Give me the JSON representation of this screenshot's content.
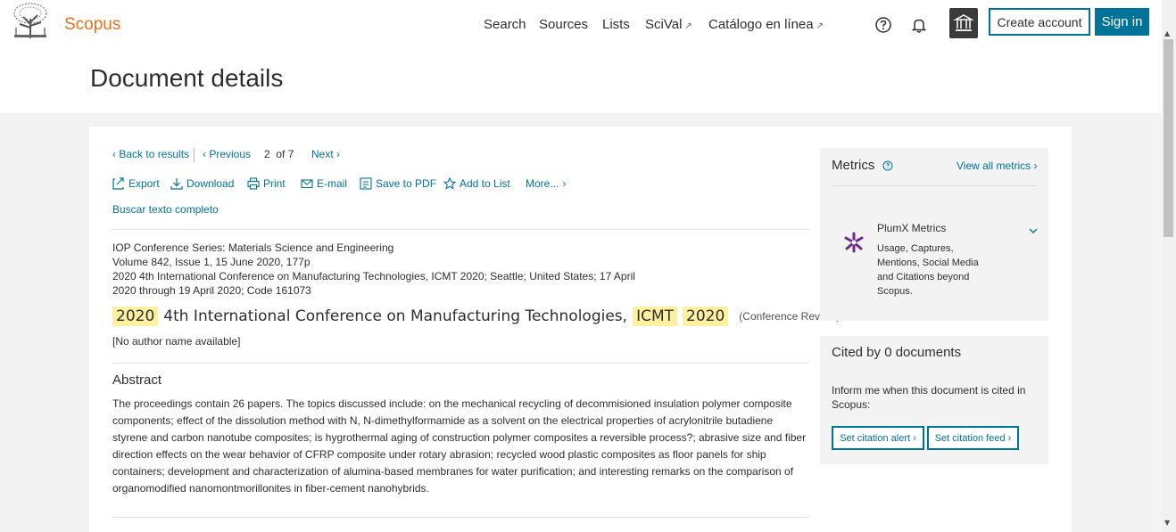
{
  "header": {
    "brand": "Scopus",
    "nav": [
      {
        "label": "Search"
      },
      {
        "label": "Sources"
      },
      {
        "label": "Lists"
      },
      {
        "label": "SciVal",
        "ext": "↗"
      },
      {
        "label": "Catálogo en línea",
        "ext": "↗"
      }
    ],
    "create_account": "Create account",
    "sign_in": "Sign in"
  },
  "page_title": "Document details",
  "pager": {
    "back": "Back to results",
    "previous": "Previous",
    "current": "2",
    "of": "of",
    "total": "7",
    "next": "Next"
  },
  "toolbar": {
    "export": "Export",
    "download": "Download",
    "print": "Print",
    "email": "E-mail",
    "save_pdf": "Save to PDF",
    "add_list": "Add to List",
    "more": "More..."
  },
  "buscar": "Buscar texto completo",
  "source": {
    "journal": "IOP Conference Series: Materials Science and Engineering",
    "volume": "Volume 842, Issue 1, 15 June 2020, 177p",
    "conf_line1": "2020 4th International Conference on Manufacturing Technologies, ICMT 2020; Seattle; United States; 17 April",
    "conf_line2": "2020 through 19 April 2020; Code 161073"
  },
  "title": {
    "hl1": "2020",
    "text": "4th International Conference on Manufacturing Technologies,",
    "hl2": "ICMT",
    "hl3": "2020",
    "type": "(Conference Review)"
  },
  "authors": "[No author name available]",
  "abstract": {
    "heading": "Abstract",
    "text": "The proceedings contain 26 papers. The topics discussed include: on the mechanical recycling of decommisioned insulation polymer composite components; effect of the dissolution method with N, N-dimethylformamide as a solvent on the electrical properties of acrylonitrile butadiene styrene and carbon nanotube composites; is hygrothermal aging of construction polymer composites a reversible process?; abrasive size and fiber direction effects on the wear behavior of CFRP composite under rotary abrasion; recycled wood plastic composites as floor panels for ship containers; development and characterization of alumina-based membranes for water purification; and interesting remarks on the comparison of organomodified nanomontmorillonites in fiber-cement nanohybrids."
  },
  "metrics": {
    "heading": "Metrics",
    "view_all": "View all metrics",
    "plumx_title": "PlumX Metrics",
    "plumx_desc": "Usage, Captures, Mentions, Social Media and Citations beyond Scopus."
  },
  "cited": {
    "heading": "Cited by 0 documents",
    "inform": "Inform me when this document is cited in Scopus:",
    "alert_btn": "Set citation alert",
    "feed_btn": "Set citation feed"
  },
  "colors": {
    "brand": "#e9711c",
    "link": "#007398",
    "highlight": "#fff0a0"
  }
}
